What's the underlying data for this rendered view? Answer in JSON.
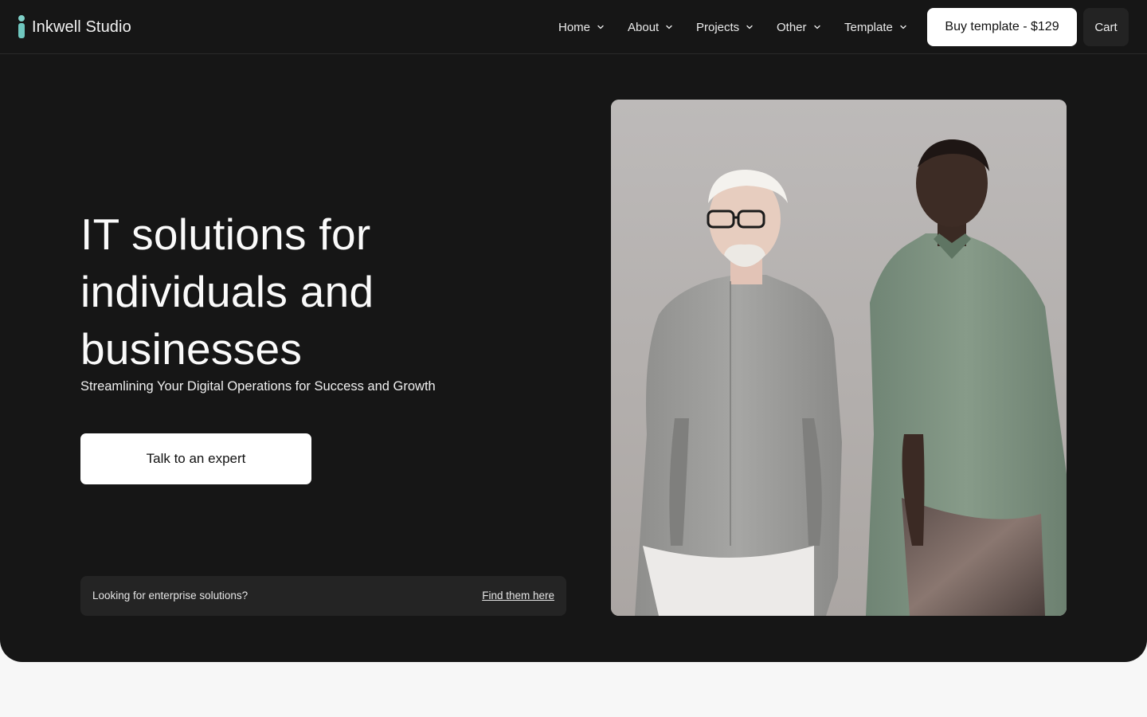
{
  "brand": {
    "name": "Inkwell Studio",
    "accent": "#6fc7bf",
    "logo_icon": "letter-i-logo-icon"
  },
  "nav": {
    "items": [
      {
        "label": "Home"
      },
      {
        "label": "About"
      },
      {
        "label": "Projects"
      },
      {
        "label": "Other"
      },
      {
        "label": "Template"
      }
    ],
    "dropdown_icon": "chevron-down-icon",
    "buy_label": "Buy template - $129",
    "cart_label": "Cart"
  },
  "hero": {
    "headline": "IT solutions for individuals and businesses",
    "subheadline": "Streamlining Your Digital Operations for Success and Growth",
    "cta_label": "Talk to an expert",
    "background": "#161616"
  },
  "enterprise": {
    "text": "Looking for enterprise solutions?",
    "link_label": "Find them here"
  }
}
